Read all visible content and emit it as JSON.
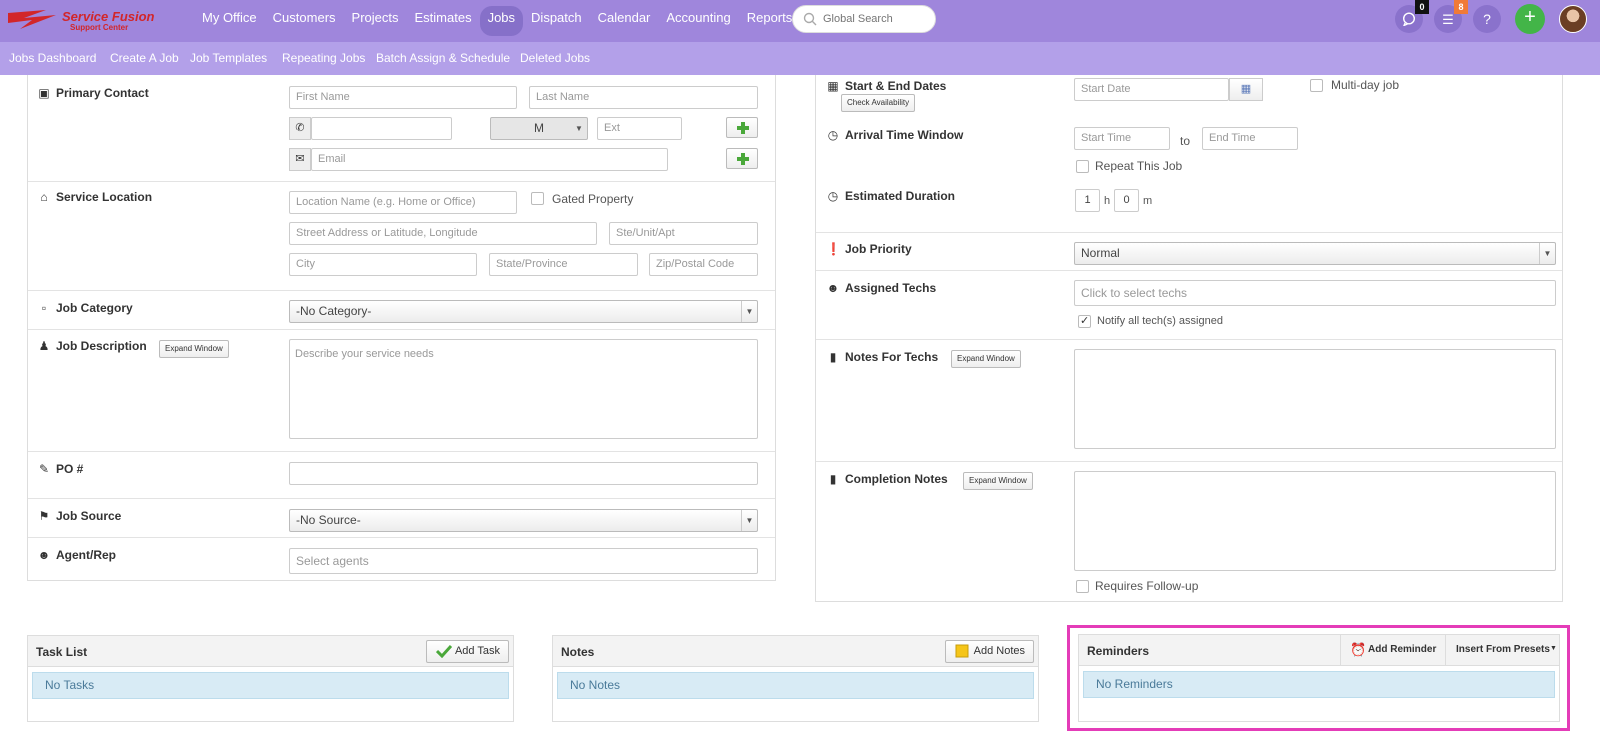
{
  "brand": {
    "name": "Service Fusion",
    "sub": "Support Center"
  },
  "nav": {
    "items": [
      "My Office",
      "Customers",
      "Projects",
      "Estimates",
      "Jobs",
      "Dispatch",
      "Calendar",
      "Accounting",
      "Reports"
    ],
    "active": "Jobs",
    "search_placeholder": "Global Search",
    "messages_badge": "0",
    "notifications_badge": "8",
    "help": "?",
    "add": "+"
  },
  "subnav": [
    "Jobs Dashboard",
    "Create A Job",
    "Job Templates",
    "Repeating Jobs",
    "Batch Assign & Schedule",
    "Deleted Jobs"
  ],
  "left": {
    "primary_contact": {
      "label": "Primary Contact",
      "first_name_ph": "First Name",
      "last_name_ph": "Last Name",
      "phone_type": "M",
      "ext_ph": "Ext",
      "email_ph": "Email"
    },
    "service_location": {
      "label": "Service Location",
      "location_name_ph": "Location Name (e.g. Home or Office)",
      "gated_label": "Gated Property",
      "street_ph": "Street Address or Latitude, Longitude",
      "ste_ph": "Ste/Unit/Apt",
      "city_ph": "City",
      "state_ph": "State/Province",
      "zip_ph": "Zip/Postal Code"
    },
    "job_category": {
      "label": "Job Category",
      "value": "-No Category-"
    },
    "job_description": {
      "label": "Job Description",
      "expand": "Expand Window",
      "placeholder": "Describe your service needs"
    },
    "po": {
      "label": "PO #"
    },
    "job_source": {
      "label": "Job Source",
      "value": "-No Source-"
    },
    "agent": {
      "label": "Agent/Rep",
      "placeholder": "Select agents"
    }
  },
  "right": {
    "dates": {
      "label": "Start & End Dates",
      "check": "Check Availability",
      "start_ph": "Start Date",
      "multiday": "Multi-day job"
    },
    "arrival": {
      "label": "Arrival Time Window",
      "start_ph": "Start Time",
      "to": "to",
      "end_ph": "End Time",
      "repeat": "Repeat This Job"
    },
    "duration": {
      "label": "Estimated Duration",
      "hours": "1",
      "h": "h",
      "minutes": "0",
      "m": "m"
    },
    "priority": {
      "label": "Job Priority",
      "value": "Normal"
    },
    "techs": {
      "label": "Assigned Techs",
      "placeholder": "Click to select techs",
      "notify": "Notify all tech(s) assigned"
    },
    "notes_techs": {
      "label": "Notes For Techs",
      "expand": "Expand Window"
    },
    "completion": {
      "label": "Completion Notes",
      "expand": "Expand Window",
      "followup": "Requires Follow-up"
    }
  },
  "cards": {
    "tasks": {
      "title": "Task List",
      "button": "Add Task",
      "empty": "No Tasks"
    },
    "notes": {
      "title": "Notes",
      "button": "Add Notes",
      "empty": "No Notes"
    },
    "reminders": {
      "title": "Reminders",
      "add": "Add Reminder",
      "presets": "Insert From Presets",
      "empty": "No Reminders"
    }
  },
  "colors": {
    "topbar": "#9f86dc",
    "subbar": "#b3a0e9",
    "highlight": "#e43cb8",
    "plus": "#43b548"
  }
}
